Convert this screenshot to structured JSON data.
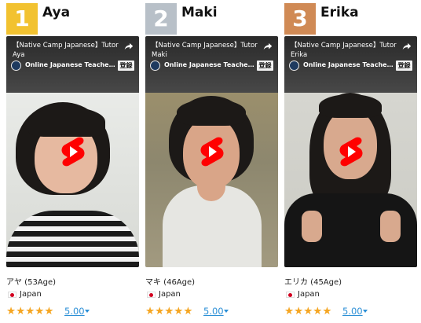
{
  "tutors": [
    {
      "rank": "1",
      "rank_color": "#f2c230",
      "name": "Aya",
      "video_title": "【Native Camp Japanese】Tutor Aya",
      "channel": "Online Japanese Teacher - Nati...",
      "subscribe": "登録",
      "age_line": "アヤ (53Age)",
      "country": "Japan",
      "stars": "★★★★★",
      "score": "5.00"
    },
    {
      "rank": "2",
      "rank_color": "#b8c0c8",
      "name": "Maki",
      "video_title": "【Native Camp Japanese】Tutor Maki",
      "channel": "Online Japanese Teacher - Nati...",
      "subscribe": "登録",
      "age_line": "マキ (46Age)",
      "country": "Japan",
      "stars": "★★★★★",
      "score": "5.00"
    },
    {
      "rank": "3",
      "rank_color": "#d08a55",
      "name": "Erika",
      "video_title": "【Native Camp Japanese】Tutor Erika",
      "channel": "Online Japanese Teacher - Nati...",
      "subscribe": "登録",
      "age_line": "エリカ (45Age)",
      "country": "Japan",
      "stars": "★★★★★",
      "score": "5.00"
    }
  ],
  "colors": {
    "star": "#f5a623",
    "link": "#2b8fd6",
    "play_red": "#ff0000"
  },
  "icons": {
    "share": "share-arrow-icon",
    "play": "shorts-play-icon",
    "flag": "japan-flag-icon",
    "channel": "channel-logo-icon"
  }
}
